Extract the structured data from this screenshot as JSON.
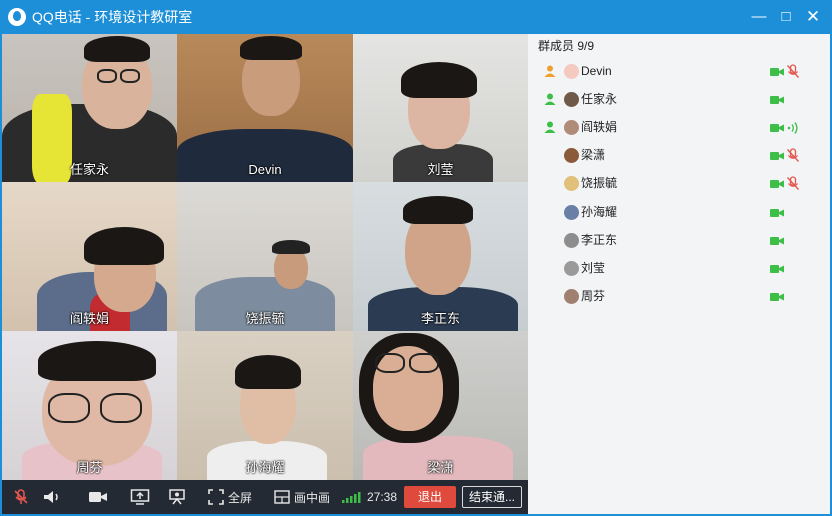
{
  "window": {
    "title": "QQ电话 - 环境设计教研室"
  },
  "video_tiles": [
    {
      "name": "任家永"
    },
    {
      "name": "Devin"
    },
    {
      "name": "刘莹"
    },
    {
      "name": "阎轶娟"
    },
    {
      "name": "饶振毓"
    },
    {
      "name": "李正东"
    },
    {
      "name": "周芬"
    },
    {
      "name": "孙海耀"
    },
    {
      "name": "梁潇"
    }
  ],
  "toolbar": {
    "fullscreen_label": "全屏",
    "pip_label": "画中画",
    "duration": "27:38",
    "exit_label": "退出",
    "end_call_label": "结束通..."
  },
  "members": {
    "header": "群成员 9/9",
    "list": [
      {
        "name": "Devin",
        "admin": true,
        "mic": "muted"
      },
      {
        "name": "任家永",
        "admin": true,
        "mic": "none"
      },
      {
        "name": "阎轶娟",
        "admin": true,
        "mic": "speaking"
      },
      {
        "name": "梁潇",
        "admin": false,
        "mic": "muted"
      },
      {
        "name": "饶振毓",
        "admin": false,
        "mic": "muted"
      },
      {
        "name": "孙海耀",
        "admin": false,
        "mic": "none"
      },
      {
        "name": "李正东",
        "admin": false,
        "mic": "none"
      },
      {
        "name": "刘莹",
        "admin": false,
        "mic": "none"
      },
      {
        "name": "周芬",
        "admin": false,
        "mic": "none"
      }
    ]
  },
  "colors": {
    "titlebar": "#1d8fd8",
    "camera_on": "#3dbf47",
    "muted": "#e4554d",
    "exit_button": "#e04a3c",
    "toolbar_bg": "#232a33"
  }
}
